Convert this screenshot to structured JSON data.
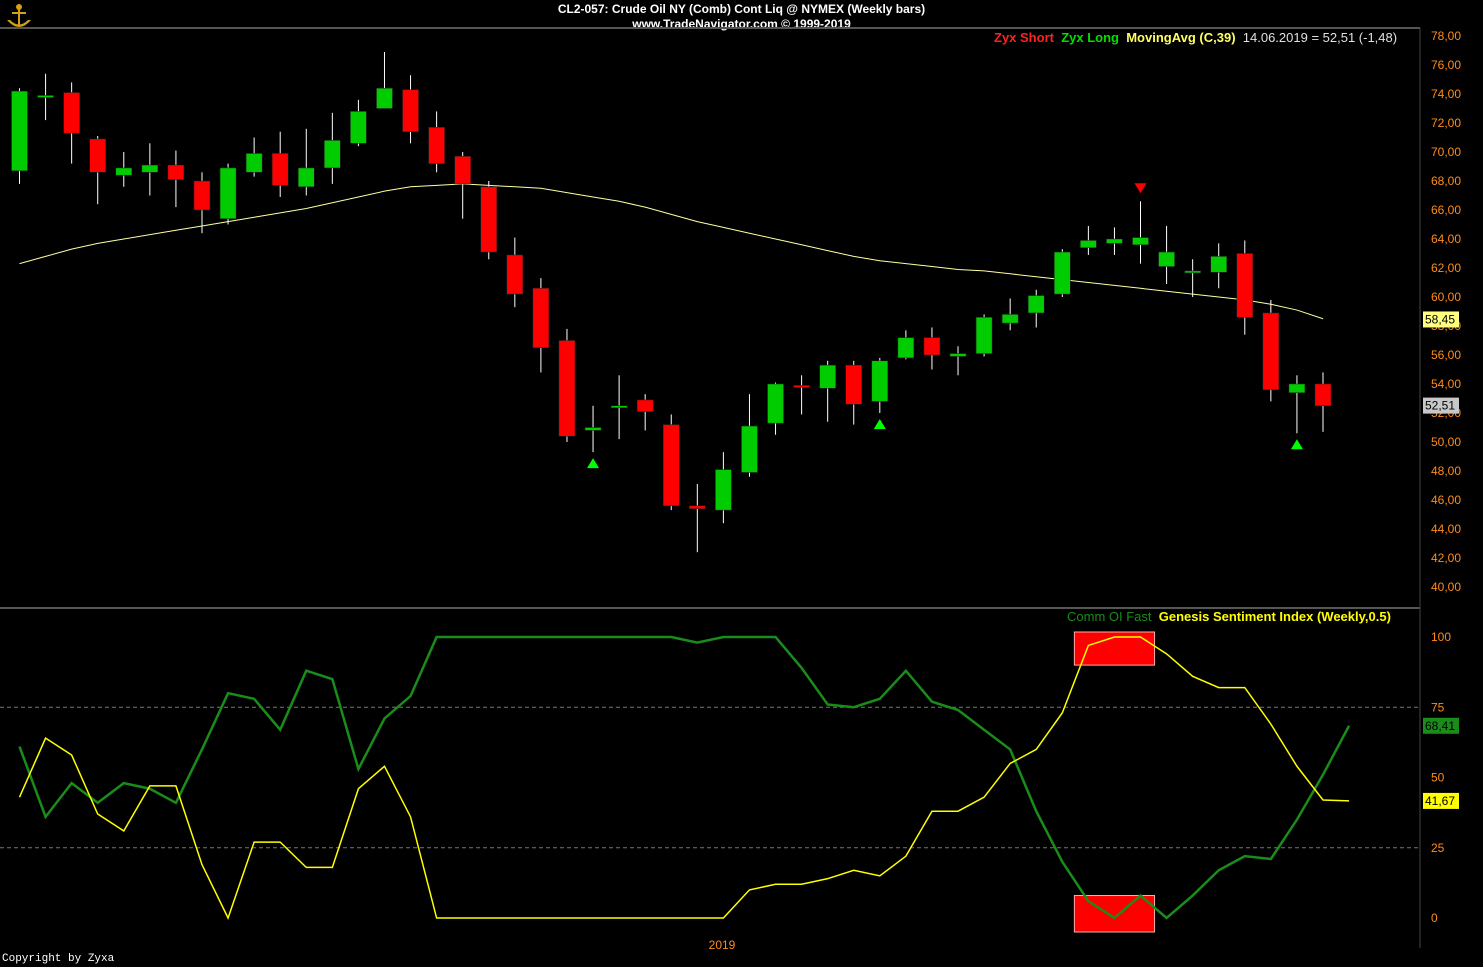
{
  "header": {
    "title": "CL2-057:  Crude Oil NY (Comb) Cont Liq @ NYMEX  (Weekly bars)",
    "subtitle": "www.TradeNavigator.com © 1999-2019"
  },
  "top_legend": {
    "short_label": "Zyx Short",
    "long_label": "Zyx Long",
    "ma_label": "MovingAvg (C,39)",
    "quote": "14.06.2019 = 52,51 (-1,48)"
  },
  "bottom_legend": {
    "comm_label": "Comm OI Fast",
    "genesis_label": "Genesis Sentiment Index (Weekly,0.5)"
  },
  "colors": {
    "background": "#000000",
    "up_candle": "#00cc00",
    "down_candle": "#ff0000",
    "wick": "#ffffff",
    "moving_average": "#ffffa0",
    "genesis": "#ffff00",
    "comm_oi": "#1a8c1a",
    "axis_text": "#ff8c1a",
    "short_label": "#ff2020",
    "long_label": "#00e000",
    "ma_label": "#ffff60",
    "quote": "#e0e0e0",
    "extreme_box": "#ff0000"
  },
  "price_axis": {
    "ticks": [
      "78,00",
      "76,00",
      "74,00",
      "72,00",
      "70,00",
      "68,00",
      "66,00",
      "64,00",
      "62,00",
      "60,00",
      "58,00",
      "56,00",
      "54,00",
      "52,00",
      "50,00",
      "48,00",
      "46,00",
      "44,00",
      "42,00",
      "40,00"
    ],
    "ma_value_label": "58,45",
    "last_price_label": "52,51"
  },
  "sentiment_axis": {
    "ticks": [
      "100",
      "75",
      "50",
      "25",
      "0"
    ],
    "comm_value_label": "68,41",
    "genesis_value_label": "41,67"
  },
  "x_axis": {
    "year_label": "2019"
  },
  "copyright": "Copyright by Zyxa",
  "chart_data": [
    {
      "type": "candlestick",
      "ylim": [
        40,
        78
      ],
      "ohlc": [
        [
          68.7,
          74.4,
          67.8,
          74.2
        ],
        [
          73.8,
          75.4,
          72.2,
          73.9
        ],
        [
          74.1,
          74.8,
          69.2,
          71.3
        ],
        [
          70.9,
          71.1,
          66.4,
          68.6
        ],
        [
          68.4,
          70.0,
          67.6,
          68.9
        ],
        [
          68.6,
          70.6,
          67.0,
          69.1
        ],
        [
          69.1,
          70.1,
          66.2,
          68.1
        ],
        [
          68.0,
          68.6,
          64.4,
          66.0
        ],
        [
          65.4,
          69.2,
          65.0,
          68.9
        ],
        [
          68.6,
          71.0,
          68.3,
          69.9
        ],
        [
          69.9,
          71.4,
          66.9,
          67.7
        ],
        [
          67.6,
          71.6,
          67.0,
          68.9
        ],
        [
          68.9,
          72.7,
          67.8,
          70.8
        ],
        [
          70.6,
          73.6,
          70.4,
          72.8
        ],
        [
          73.0,
          76.9,
          73.1,
          74.4
        ],
        [
          74.3,
          75.3,
          70.6,
          71.4
        ],
        [
          71.7,
          72.8,
          68.6,
          69.2
        ],
        [
          69.7,
          70.0,
          65.4,
          67.8
        ],
        [
          67.6,
          68.0,
          62.6,
          63.1
        ],
        [
          62.9,
          64.1,
          59.3,
          60.2
        ],
        [
          60.6,
          61.3,
          54.8,
          56.5
        ],
        [
          57.0,
          57.8,
          50.0,
          50.4
        ],
        [
          50.8,
          52.5,
          49.3,
          51.0
        ],
        [
          52.5,
          54.6,
          50.2,
          52.5
        ],
        [
          52.9,
          53.3,
          50.8,
          52.1
        ],
        [
          51.2,
          51.9,
          45.3,
          45.6
        ],
        [
          45.6,
          47.1,
          42.4,
          45.4
        ],
        [
          45.3,
          49.3,
          44.4,
          48.1
        ],
        [
          47.9,
          53.3,
          47.6,
          51.1
        ],
        [
          51.3,
          54.1,
          50.5,
          54.0
        ],
        [
          53.9,
          54.6,
          51.9,
          53.8
        ],
        [
          53.7,
          55.6,
          51.4,
          55.3
        ],
        [
          55.3,
          55.6,
          51.2,
          52.6
        ],
        [
          52.8,
          55.8,
          52.0,
          55.6
        ],
        [
          55.8,
          57.7,
          55.7,
          57.2
        ],
        [
          57.2,
          57.9,
          55.0,
          56.0
        ],
        [
          55.9,
          56.6,
          54.6,
          56.1
        ],
        [
          56.1,
          58.8,
          55.9,
          58.6
        ],
        [
          58.2,
          59.9,
          57.7,
          58.8
        ],
        [
          58.9,
          60.5,
          57.9,
          60.1
        ],
        [
          60.2,
          63.3,
          60.0,
          63.1
        ],
        [
          63.4,
          64.9,
          62.9,
          63.9
        ],
        [
          63.7,
          64.8,
          62.9,
          64.0
        ],
        [
          63.6,
          66.6,
          62.3,
          64.1
        ],
        [
          62.1,
          64.9,
          60.9,
          63.1
        ],
        [
          61.7,
          62.6,
          60.0,
          61.8
        ],
        [
          61.7,
          63.7,
          60.6,
          62.8
        ],
        [
          63.0,
          63.9,
          57.4,
          58.6
        ],
        [
          58.9,
          59.8,
          52.8,
          53.6
        ],
        [
          53.4,
          54.6,
          50.6,
          54.0
        ],
        [
          54.0,
          54.8,
          50.7,
          52.5
        ]
      ],
      "moving_average_39": [
        62.3,
        62.8,
        63.3,
        63.7,
        64.0,
        64.3,
        64.6,
        64.9,
        65.2,
        65.5,
        65.8,
        66.1,
        66.5,
        66.9,
        67.3,
        67.6,
        67.7,
        67.8,
        67.7,
        67.6,
        67.5,
        67.2,
        66.9,
        66.6,
        66.2,
        65.7,
        65.2,
        64.8,
        64.4,
        64.0,
        63.6,
        63.2,
        62.8,
        62.5,
        62.3,
        62.1,
        61.9,
        61.8,
        61.6,
        61.4,
        61.2,
        61.0,
        60.8,
        60.6,
        60.4,
        60.2,
        60.0,
        59.8,
        59.5,
        59.1,
        58.5
      ],
      "signals": [
        {
          "bar": 43,
          "type": "short"
        },
        {
          "bar": 22,
          "type": "long"
        },
        {
          "bar": 33,
          "type": "long"
        },
        {
          "bar": 49,
          "type": "long"
        }
      ],
      "last_price": 52.51,
      "ma_last": 58.45
    },
    {
      "type": "line",
      "ylim": [
        0,
        100
      ],
      "series": [
        {
          "name": "Comm OI Fast",
          "values": [
            61,
            36,
            48,
            41,
            48,
            46,
            41,
            60,
            80,
            78,
            67,
            88,
            85,
            53,
            71,
            79,
            100,
            100,
            100,
            100,
            100,
            100,
            100,
            100,
            100,
            100,
            98,
            100,
            100,
            100,
            89,
            76,
            75,
            78,
            88,
            77,
            74,
            67,
            60,
            38,
            20,
            6,
            0,
            8,
            0,
            8,
            17,
            22,
            21,
            35,
            51,
            68.41
          ]
        },
        {
          "name": "Genesis Sentiment Index (Weekly,0.5)",
          "values": [
            43,
            64,
            58,
            37,
            31,
            47,
            47,
            19,
            0,
            27,
            27,
            18,
            18,
            46,
            54,
            36,
            0,
            0,
            0,
            0,
            0,
            0,
            0,
            0,
            0,
            0,
            0,
            0,
            10,
            12,
            12,
            14,
            17,
            15,
            22,
            38,
            38,
            43,
            55,
            60,
            73,
            97,
            100,
            100,
            94,
            86,
            82,
            82,
            69,
            54,
            42,
            41.67
          ]
        }
      ],
      "extreme_zones": [
        {
          "from_bar": 41,
          "to_bar": 43,
          "level": "top"
        },
        {
          "from_bar": 41,
          "to_bar": 43,
          "level": "bottom"
        }
      ],
      "reference_lines": [
        25,
        75
      ]
    }
  ]
}
